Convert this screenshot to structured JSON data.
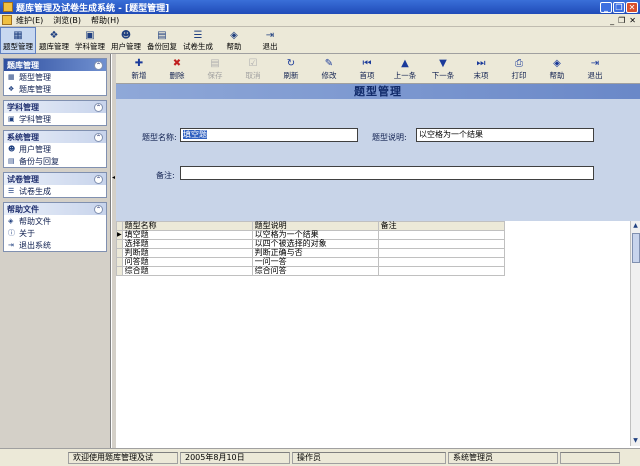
{
  "window": {
    "title": "题库管理及试卷生成系统 - [题型管理]"
  },
  "menu": {
    "items": [
      "维护(E)",
      "浏览(B)",
      "帮助(H)"
    ]
  },
  "toolbar": {
    "items": [
      {
        "label": "题型管理",
        "icon": "grid-icon"
      },
      {
        "label": "题库管理",
        "icon": "database-icon"
      },
      {
        "label": "学科管理",
        "icon": "book-icon"
      },
      {
        "label": "用户管理",
        "icon": "user-icon"
      },
      {
        "label": "备份回复",
        "icon": "disk-icon"
      },
      {
        "label": "试卷生成",
        "icon": "list-icon"
      },
      {
        "label": "帮助",
        "icon": "help-book-icon"
      },
      {
        "label": "退出",
        "icon": "exit-icon"
      }
    ]
  },
  "sidebar": {
    "sections": [
      {
        "title": "题库管理",
        "items": [
          "题型管理",
          "题库管理"
        ]
      },
      {
        "title": "学科管理",
        "items": [
          "学科管理"
        ]
      },
      {
        "title": "系统管理",
        "items": [
          "用户管理",
          "备份与回复"
        ]
      },
      {
        "title": "试卷管理",
        "items": [
          "试卷生成"
        ]
      },
      {
        "title": "帮助文件",
        "items": [
          "帮助文件",
          "关于",
          "退出系统"
        ]
      }
    ]
  },
  "formbar": {
    "items": [
      {
        "label": "新增",
        "icon": "new-icon",
        "disabled": false
      },
      {
        "label": "删除",
        "icon": "delete-icon",
        "disabled": false
      },
      {
        "label": "保存",
        "icon": "save-icon",
        "disabled": true
      },
      {
        "label": "取消",
        "icon": "cancel-icon",
        "disabled": true
      },
      {
        "label": "刷新",
        "icon": "refresh-icon",
        "disabled": false
      },
      {
        "label": "修改",
        "icon": "edit-icon",
        "disabled": false
      },
      {
        "label": "首项",
        "icon": "first-icon",
        "disabled": false
      },
      {
        "label": "上一条",
        "icon": "prev-icon",
        "disabled": false
      },
      {
        "label": "下一条",
        "icon": "next-icon",
        "disabled": false
      },
      {
        "label": "末项",
        "icon": "last-icon",
        "disabled": false
      },
      {
        "label": "打印",
        "icon": "print-icon",
        "disabled": false
      },
      {
        "label": "帮助",
        "icon": "help-icon",
        "disabled": false
      },
      {
        "label": "退出",
        "icon": "exit-icon",
        "disabled": false
      }
    ]
  },
  "form": {
    "title": "题型管理",
    "name_label": "题型名称:",
    "name_value": "填空题",
    "desc_label": "题型说明:",
    "desc_value": "以空格为一个结果",
    "note_label": "备注:",
    "note_value": ""
  },
  "grid": {
    "columns": [
      "题型名称",
      "题型说明",
      "备注"
    ],
    "rows": [
      [
        "填空题",
        "以空格为一个结果",
        ""
      ],
      [
        "选择题",
        "以四个被选择的对象",
        ""
      ],
      [
        "判断题",
        "判断正确与否",
        ""
      ],
      [
        "问答题",
        "一问一答",
        ""
      ],
      [
        "综合题",
        "综合问答",
        ""
      ]
    ],
    "current_row": 0
  },
  "status": {
    "welcome": "欢迎使用题库管理及试",
    "date": "2005年8月10日",
    "operator_label": "操作员",
    "role": "系统管理员"
  },
  "colors": {
    "title_bar": "#1f4bb8",
    "form_title": "#6a88c8",
    "form_area": "#c8d4e8"
  }
}
